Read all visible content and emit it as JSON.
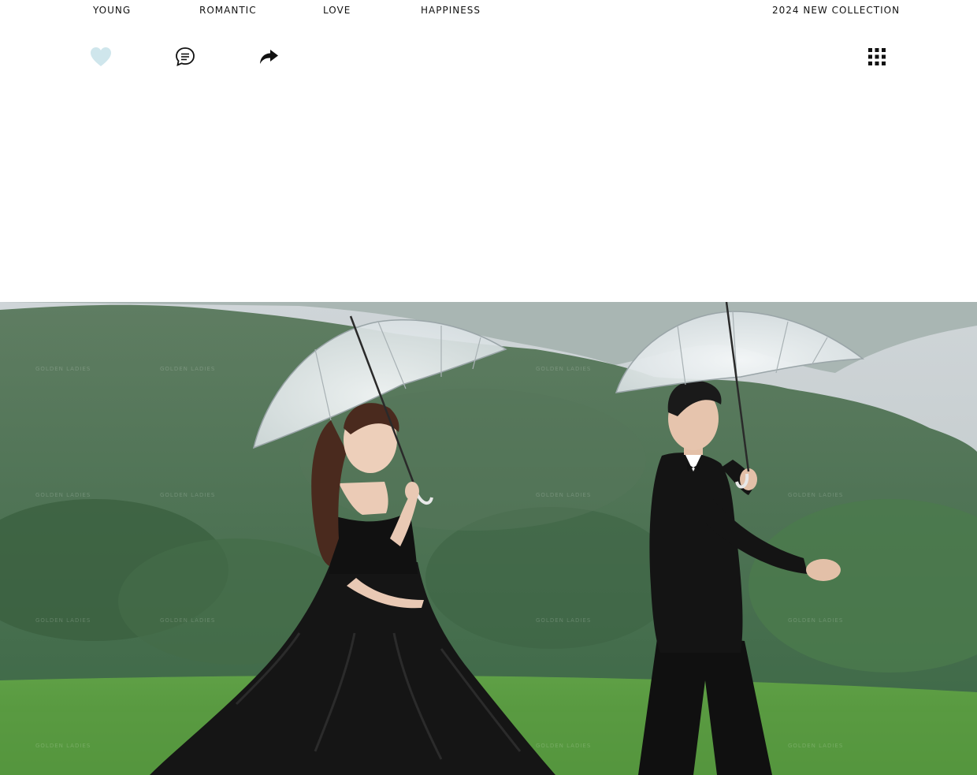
{
  "nav": {
    "items": [
      "YOUNG",
      "ROMANTIC",
      "LOVE",
      "HAPPINESS"
    ],
    "collection_label": "2024 NEW COLLECTION"
  },
  "toolbar": {
    "icons": [
      "heart-icon",
      "comment-icon",
      "share-icon",
      "grid-menu-icon"
    ],
    "heart_color": "#cfe6ec"
  },
  "photo": {
    "watermark_text": "GOLDEN LADIES"
  }
}
